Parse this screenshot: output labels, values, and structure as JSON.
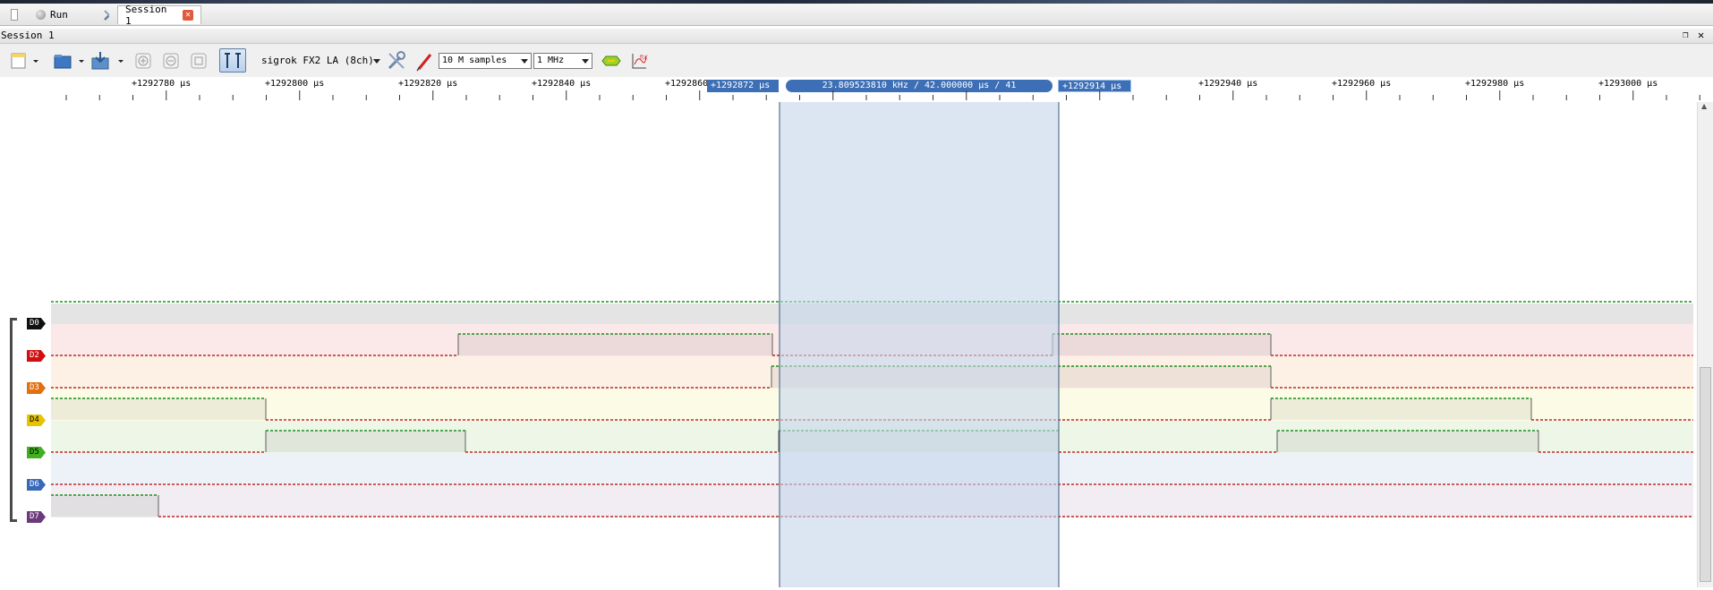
{
  "tabs": [
    {
      "label": "Run",
      "icon": "run-led-icon"
    },
    {
      "label": "Session 1",
      "icon": "close-icon"
    }
  ],
  "session": {
    "title": "Session 1"
  },
  "toolbar": {
    "device": "sigrok FX2 LA (8ch)",
    "samples": "10 M samples",
    "samplerate": "1 MHz"
  },
  "ruler": {
    "ticks": [
      "+1292780 μs",
      "+1292800 μs",
      "+1292820 μs",
      "+1292840 μs",
      "+1292860",
      "+1292940 μs",
      "+1292960 μs",
      "+1292980 μs",
      "+1293000 μs"
    ],
    "cursor_a": "+1292872 μs",
    "cursor_b": "+1292914 μs",
    "measurement": "23.809523810 kHz / 42.000000 μs / 41"
  },
  "channels": [
    {
      "name": "D0",
      "color": "#101010",
      "bg": "#e4e4e4"
    },
    {
      "name": "D2",
      "color": "#d01010",
      "bg": "#fbe8e8"
    },
    {
      "name": "D3",
      "color": "#e07010",
      "bg": "#fdf1e6"
    },
    {
      "name": "D4",
      "color": "#e8c400",
      "bg": "#fbfbe6"
    },
    {
      "name": "D5",
      "color": "#40b020",
      "bg": "#eef6e8"
    },
    {
      "name": "D6",
      "color": "#3868b8",
      "bg": "#edf1f8"
    },
    {
      "name": "D7",
      "color": "#6a3a7a",
      "bg": "#f1edf2"
    }
  ],
  "colors": {
    "high": "#18901a",
    "low": "#c02828",
    "edge": "#606060",
    "cursor_region": "#c7d7ec",
    "flag": "#3d6fb6"
  }
}
